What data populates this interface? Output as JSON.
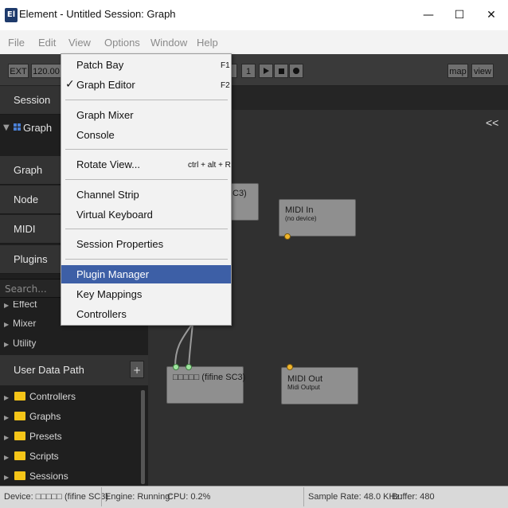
{
  "window": {
    "icon_text": "El",
    "title": "Element - Untitled Session: Graph",
    "minimize": "—",
    "maximize": "☐",
    "close": "✕"
  },
  "menubar": [
    "File",
    "Edit",
    "View",
    "Options",
    "Window",
    "Help"
  ],
  "toolbar": {
    "ext": "EXT",
    "tempo": "120.00",
    "bar_field": "1",
    "map": "map",
    "view": "view"
  },
  "sidebar": {
    "session": "Session",
    "graph_item": "Graph",
    "graph": "Graph",
    "node": "Node",
    "midi": "MIDI",
    "plugins": "Plugins",
    "search_placeholder": "Search...",
    "categories": [
      "Effect",
      "Mixer",
      "Utility"
    ],
    "user_data_path": "User Data Path",
    "add": "+",
    "folders": [
      "Controllers",
      "Graphs",
      "Presets",
      "Scripts",
      "Sessions"
    ]
  },
  "canvas": {
    "collapse": "<<",
    "node_partial": "C3)",
    "midi_in_title": "MIDI In",
    "midi_in_sub": "(no device)",
    "audio_node_title": "□□□□□ (fifine SC3)",
    "midi_out_title": "MIDI Out",
    "midi_out_sub": "Midi Output"
  },
  "status": {
    "device": "Device: □□□□□ (fifine SC3)",
    "engine": "Engine: Running:",
    "cpu": "CPU: 0.2%",
    "sample_rate": "Sample Rate: 48.0 KHz:",
    "buffer": "Buffer: 480"
  },
  "view_menu": {
    "items": [
      {
        "label": "Patch Bay",
        "shortcut": "F1"
      },
      {
        "label": "Graph Editor",
        "shortcut": "F2",
        "checked": "✓"
      },
      {
        "label": "Graph Mixer"
      },
      {
        "label": "Console"
      },
      {
        "label": "Rotate View...",
        "shortcut": "ctrl + alt + R"
      },
      {
        "label": "Channel Strip"
      },
      {
        "label": "Virtual Keyboard"
      },
      {
        "label": "Session Properties"
      },
      {
        "label": "Plugin Manager"
      },
      {
        "label": "Key Mappings"
      },
      {
        "label": "Controllers"
      }
    ]
  },
  "colors": {
    "highlight": "#3d5fa6",
    "folder": "#f5c518",
    "port_midi": "#f0b52a",
    "port_audio": "#9ee59e"
  }
}
